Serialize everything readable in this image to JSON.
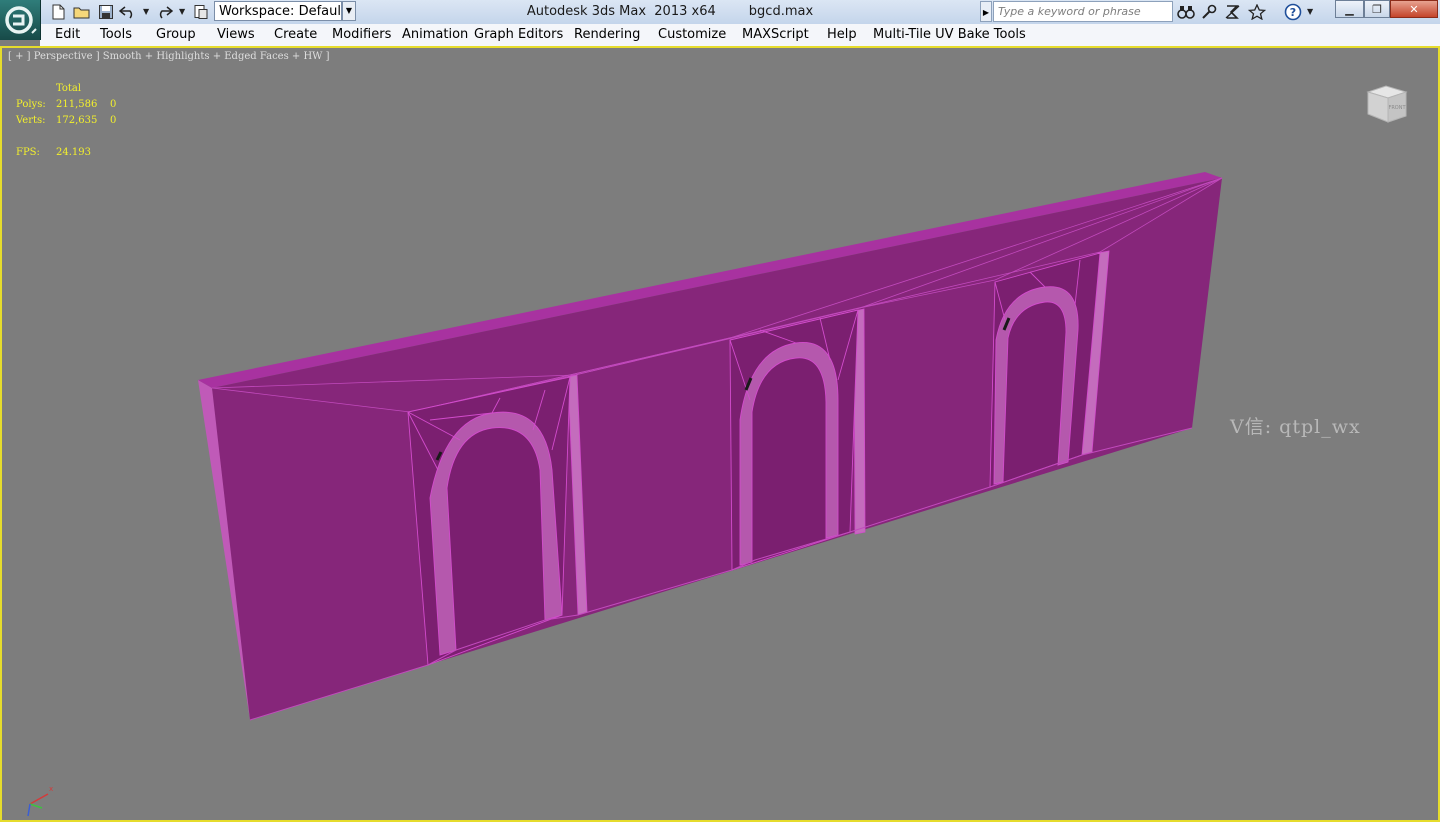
{
  "titlebar": {
    "app_title": "Autodesk 3ds Max  2013 x64",
    "file_name": "bgcd.max",
    "workspace_value": "Workspace: Default",
    "search_placeholder": "Type a keyword or phrase"
  },
  "menu": {
    "items": [
      "Edit",
      "Tools",
      "Group",
      "Views",
      "Create",
      "Modifiers",
      "Animation",
      "Graph Editors",
      "Rendering",
      "Customize",
      "MAXScript",
      "Help",
      "Multi-Tile UV Bake Tools"
    ]
  },
  "viewport": {
    "label": "[ + ] Perspective ] Smooth + Highlights + Edged Faces + HW ]",
    "stats": {
      "header": "Total",
      "polys_label": "Polys:",
      "polys_total": "211,586",
      "polys_selected": "0",
      "verts_label": "Verts:",
      "verts_total": "172,635",
      "verts_selected": "0",
      "fps_label": "FPS:",
      "fps_value": "24.193"
    },
    "viewcube_face": "FRONT",
    "watermark": "V信: qtpl_wx",
    "axis_x": "x"
  },
  "colors": {
    "viewport_bg": "#7d7d7d",
    "active_border": "#e6dc2c",
    "wall_face": "#86267a",
    "wall_top": "#a832a0",
    "wireframe": "#d24ccc",
    "stats_text": "#f3f02c"
  }
}
